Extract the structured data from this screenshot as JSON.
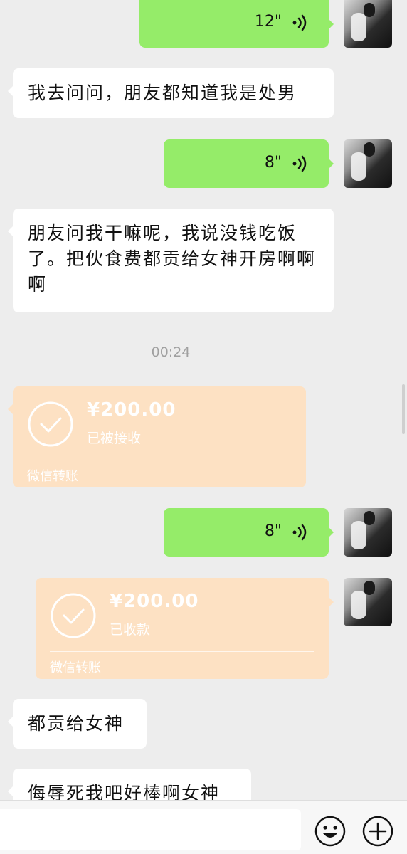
{
  "messages": {
    "voice1": {
      "duration": "12\""
    },
    "text1": "我去问问，朋友都知道我是处男",
    "voice2": {
      "duration": "8\""
    },
    "text2": "朋友问我干嘛呢，我说没钱吃饭了。把伙食费都贡给女神开房啊啊啊",
    "timestamp": "00:24",
    "transfer1": {
      "amount": "¥200.00",
      "status": "已被接收",
      "label": "微信转账"
    },
    "voice3": {
      "duration": "8\""
    },
    "transfer2": {
      "amount": "¥200.00",
      "status": "已收款",
      "label": "微信转账"
    },
    "text3": "都贡给女神",
    "text4": "侮辱死我吧好棒啊女神"
  },
  "icons": {
    "voice": "voice-wave-icon",
    "transfer": "check-circle-icon",
    "emoji": "emoji-icon",
    "more": "plus-circle-icon"
  },
  "colors": {
    "background": "#ededed",
    "voice_bubble": "#95ec69",
    "incoming_bubble": "#ffffff",
    "transfer_card": "#fde1c3"
  }
}
